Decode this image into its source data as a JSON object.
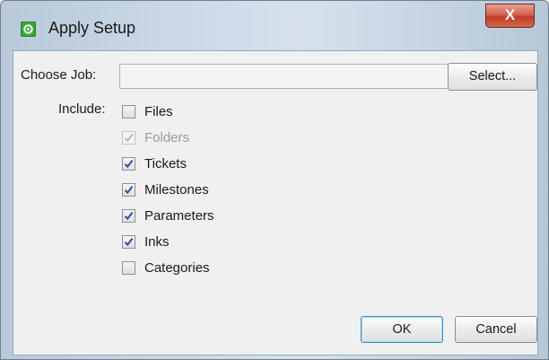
{
  "window": {
    "title": "Apply Setup",
    "close_label": "X"
  },
  "form": {
    "choose_job_label": "Choose Job:",
    "choose_job_value": "",
    "select_button": "Select...",
    "include_label": "Include:"
  },
  "include_options": [
    {
      "label": "Files",
      "checked": false,
      "enabled": true
    },
    {
      "label": "Folders",
      "checked": true,
      "enabled": false
    },
    {
      "label": "Tickets",
      "checked": true,
      "enabled": true
    },
    {
      "label": "Milestones",
      "checked": true,
      "enabled": true
    },
    {
      "label": "Parameters",
      "checked": true,
      "enabled": true
    },
    {
      "label": "Inks",
      "checked": true,
      "enabled": true
    },
    {
      "label": "Categories",
      "checked": false,
      "enabled": true
    }
  ],
  "buttons": {
    "ok": "OK",
    "cancel": "Cancel"
  },
  "colors": {
    "app_icon": "#3aa536",
    "close_button": "#c13c24",
    "checkmark": "#2b4f9e"
  }
}
